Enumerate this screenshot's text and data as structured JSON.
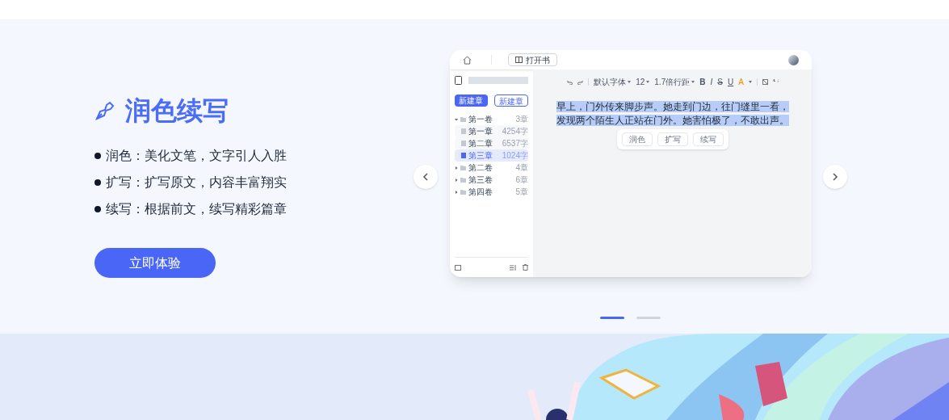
{
  "feature": {
    "title": "润色续写",
    "bullets": [
      {
        "label": "润色：",
        "text": "美化文笔，文字引人入胜"
      },
      {
        "label": "扩写：",
        "text": "扩写原文，内容丰富翔实"
      },
      {
        "label": "续写：",
        "text": "根据前文，续写精彩篇章"
      }
    ],
    "cta": "立即体验"
  },
  "mockup": {
    "open_book_button": "打开书",
    "sidebar": {
      "new_buttons": [
        {
          "label": "新建章",
          "kind": "filled"
        },
        {
          "label": "新建章",
          "kind": "outline"
        }
      ],
      "volumes": [
        {
          "title": "第一卷",
          "count": "3章",
          "expanded": true,
          "children": [
            {
              "title": "第一章",
              "count": "4254字",
              "selected": false
            },
            {
              "title": "第二章",
              "count": "6537字",
              "selected": false
            },
            {
              "title": "第三章",
              "count": "1024字",
              "selected": true
            }
          ]
        },
        {
          "title": "第二卷",
          "count": "4章",
          "expanded": false
        },
        {
          "title": "第三卷",
          "count": "6章",
          "expanded": false
        },
        {
          "title": "第四卷",
          "count": "5章",
          "expanded": false
        }
      ]
    },
    "toolbar": {
      "font": "默认字体",
      "size": "12",
      "line_spacing": "1.7倍行距",
      "formats": [
        "B",
        "I",
        "S",
        "U",
        "A"
      ]
    },
    "editor": {
      "lines": [
        "早上，门外传来脚步声。她走到门边，往门缝里一看，",
        "发现两个陌生人正站在门外。她害怕极了，不敢出声。"
      ],
      "actions": [
        "润色",
        "扩写",
        "续写"
      ]
    }
  },
  "carousel": {
    "dots": [
      {
        "selected": true
      },
      {
        "selected": false
      }
    ]
  }
}
